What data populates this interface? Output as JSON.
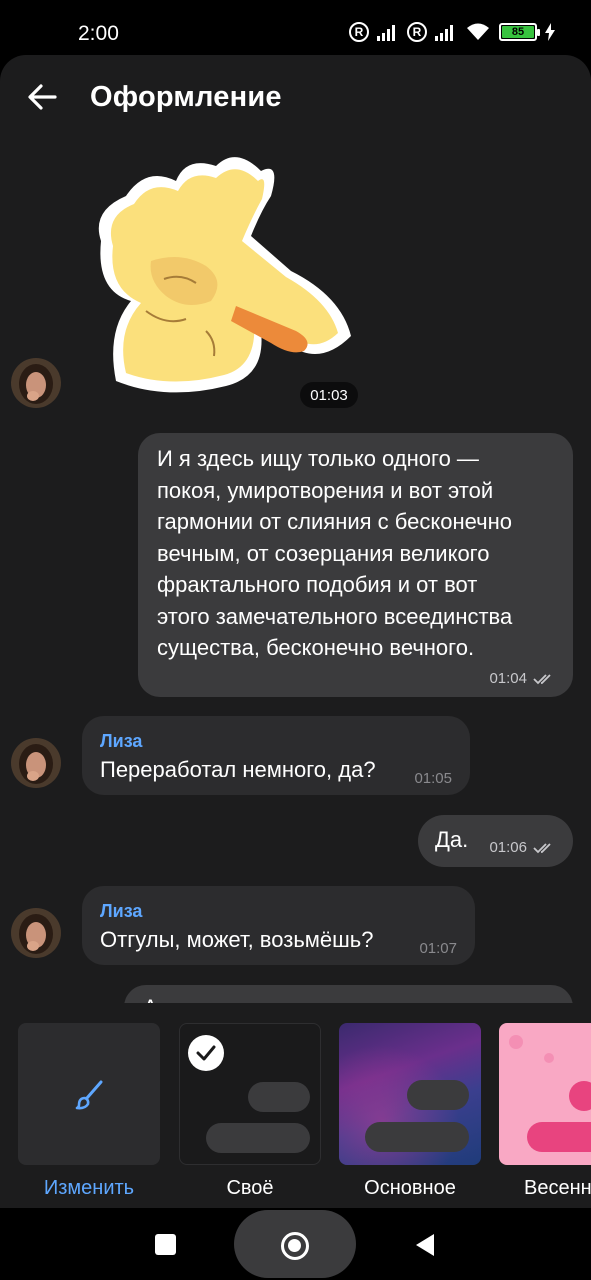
{
  "status_bar": {
    "time": "2:00",
    "battery": "85",
    "reg_mark_1": "R",
    "reg_mark_2": "R"
  },
  "header": {
    "title": "Оформление",
    "back_icon": "arrow-left-icon"
  },
  "messages": {
    "sticker_time": "01:03",
    "long_out": {
      "lines": [
        "И я здесь ищу только одного —",
        "покоя, умиротворения и вот этой",
        "гармонии от слияния с бесконечно",
        "вечным, от созерцания великого",
        "фрактального подобия и от вот",
        "этого замечательного всеединства",
        "существа, бесконечно вечного."
      ],
      "time": "01:04"
    },
    "in_1": {
      "sender": "Лиза",
      "text": "Переработал немного, да?",
      "time": "01:05"
    },
    "out_2": {
      "text": "Да.",
      "time": "01:06"
    },
    "in_2": {
      "sender": "Лиза",
      "text": "Отгулы, может, возьмёшь?",
      "time": "01:07"
    },
    "partial_next": "А"
  },
  "picker": {
    "items": [
      {
        "label": "Изменить",
        "icon": "brush-icon"
      },
      {
        "label": "Своё",
        "icon": "check-icon"
      },
      {
        "label": "Основное"
      },
      {
        "label": "Весенн"
      }
    ]
  },
  "colors": {
    "accent": "#5ea7ff",
    "bubble_out": "#3b3b3d",
    "bubble_in": "#2c2c2e",
    "background": "#1c1c1d"
  }
}
